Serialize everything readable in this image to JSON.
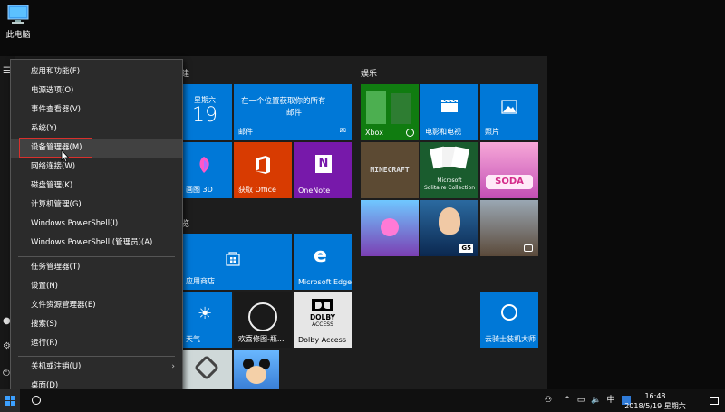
{
  "desktop": {
    "icon_label": "此电脑"
  },
  "groups": {
    "g1": "建",
    "g2": "娱乐",
    "g3": "览"
  },
  "tiles": {
    "calendar": {
      "weekday": "星期六",
      "day": "19"
    },
    "mail": {
      "line1": "在一个位置获取你的所有",
      "line2": "邮件",
      "label": "邮件"
    },
    "paint3d": "画图 3D",
    "office": "获取 Office",
    "onenote": "OneNote",
    "store": "应用商店",
    "edge": "Microsoft Edge",
    "weather": "天气",
    "loading": "欢喜修图-瓶...",
    "dolby": {
      "logo1": "DOLBY",
      "logo2": "ACCESS",
      "label": "Dolby Access"
    },
    "xbox": "Xbox",
    "movies": "电影和电视",
    "photos": "照片",
    "minecraft": "MINECRAFT",
    "solitaire": {
      "line1": "Microsoft",
      "line2": "Solitaire Collection"
    },
    "soda": "SODA",
    "g5": "G5",
    "guard": "云骑士装机大师"
  },
  "context_menu": {
    "items": [
      "应用和功能(F)",
      "电源选项(O)",
      "事件查看器(V)",
      "系统(Y)",
      "设备管理器(M)",
      "网络连接(W)",
      "磁盘管理(K)",
      "计算机管理(G)",
      "Windows PowerShell(I)",
      "Windows PowerShell (管理员)(A)",
      "任务管理器(T)",
      "设置(N)",
      "文件资源管理器(E)",
      "搜索(S)",
      "运行(R)",
      "关机或注销(U)",
      "桌面(D)"
    ]
  },
  "taskbar": {
    "ime": "中",
    "time": "16:48",
    "date": "2018/5/19 星期六"
  },
  "colors": {
    "accent": "#0078d7",
    "highlight": "#d9302c",
    "office": "#d83b01",
    "onenote": "#7719aa"
  }
}
